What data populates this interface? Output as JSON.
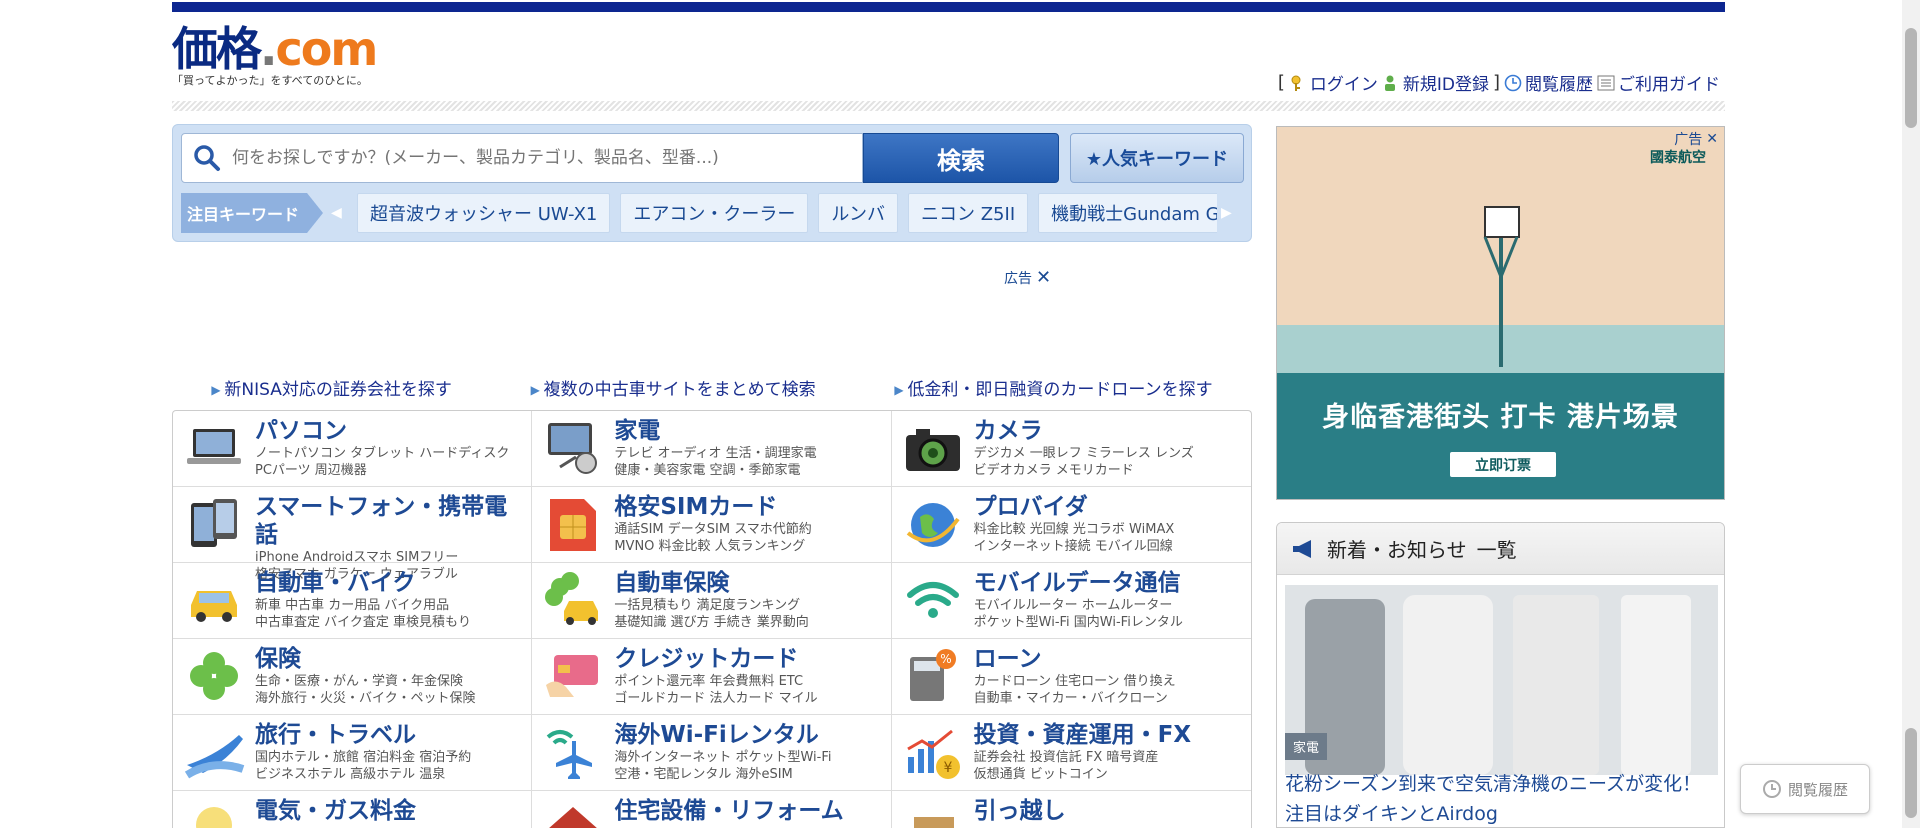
{
  "header": {
    "logo_main": "価格",
    "logo_dot": ".",
    "logo_com": "com",
    "tagline": "「買ってよかった」をすべてのひとに。",
    "links": {
      "open_bracket": "[",
      "login": "ログイン",
      "register": "新規ID登録",
      "close_bracket": "]",
      "history": "閲覧履歴",
      "guide": "ご利用ガイド"
    }
  },
  "search": {
    "placeholder": "何をお探しですか？(メーカー、製品カテゴリ、製品名、型番...)",
    "button": "検索",
    "popular": "★人気キーワード",
    "keyword_label": "注目キーワード",
    "keywords": [
      "超音波ウォッシャー UW-X1",
      "エアコン・クーラー",
      "ルンバ",
      "ニコン Z5II",
      "機動戦士Gundam G"
    ]
  },
  "ad": {
    "label": "広告",
    "close": "✕"
  },
  "promo_links": [
    "新NISA対応の証券会社を探す",
    "複数の中古車サイトをまとめて検索",
    "低金利・即日融資のカードローンを探す"
  ],
  "categories": [
    {
      "title": "パソコン",
      "sub1": "ノートパソコン  タブレット  ハードディスク",
      "sub2": "PCパーツ  周辺機器",
      "icon": "laptop-icon"
    },
    {
      "title": "家電",
      "sub1": "テレビ  オーディオ  生活・調理家電",
      "sub2": "健康・美容家電  空調・季節家電",
      "icon": "appliance-icon"
    },
    {
      "title": "カメラ",
      "sub1": "デジカメ  一眼レフ  ミラーレス  レンズ",
      "sub2": "ビデオカメラ  メモリカード",
      "icon": "camera-icon"
    },
    {
      "title": "スマートフォン・携帯電話",
      "sub1": "iPhone  Androidスマホ  SIMフリー",
      "sub2": "格安スマホ  ガラケー  ウェアラブル",
      "icon": "smartphone-icon"
    },
    {
      "title": "格安SIMカード",
      "sub1": "通話SIM  データSIM  スマホ代節約",
      "sub2": "MVNO  料金比較  人気ランキング",
      "icon": "sim-card-icon"
    },
    {
      "title": "プロバイダ",
      "sub1": "料金比較  光回線  光コラボ  WiMAX",
      "sub2": "インターネット接続  モバイル回線",
      "icon": "globe-icon"
    },
    {
      "title": "自動車・バイク",
      "sub1": "新車  中古車  カー用品  バイク用品",
      "sub2": "中古車査定  バイク査定  車検見積もり",
      "icon": "car-icon"
    },
    {
      "title": "自動車保険",
      "sub1": "一括見積もり  満足度ランキング",
      "sub2": "基礎知識  選び方  手続き  業界動向",
      "icon": "car-insurance-icon"
    },
    {
      "title": "モバイルデータ通信",
      "sub1": "モバイルルーター  ホームルーター",
      "sub2": "ポケット型Wi-Fi  国内Wi-Fiレンタル",
      "icon": "wifi-icon"
    },
    {
      "title": "保険",
      "sub1": "生命・医療・がん・学資・年金保険",
      "sub2": "海外旅行・火災・バイク・ペット保険",
      "icon": "clover-icon"
    },
    {
      "title": "クレジットカード",
      "sub1": "ポイント還元率  年会費無料  ETC",
      "sub2": "ゴールドカード  法人カード  マイル",
      "icon": "credit-card-icon"
    },
    {
      "title": "ローン",
      "sub1": "カードローン  住宅ローン  借り換え",
      "sub2": "自動車・マイカー・バイクローン",
      "icon": "calculator-icon"
    },
    {
      "title": "旅行・トラベル",
      "sub1": "国内ホテル・旅館  宿泊料金  宿泊予約",
      "sub2": "ビジネスホテル  高級ホテル  温泉",
      "icon": "airplane-icon"
    },
    {
      "title": "海外Wi-Fiレンタル",
      "sub1": "海外インターネット  ポケット型Wi-Fi",
      "sub2": "空港・宅配レンタル  海外eSIM",
      "icon": "wifi-plane-icon"
    },
    {
      "title": "投資・資産運用・FX",
      "sub1": "証券会社  投資信託  FX  暗号資産",
      "sub2": "仮想通貨  ビットコイン",
      "icon": "chart-yen-icon"
    },
    {
      "title": "電気・ガス料金",
      "sub1": "",
      "sub2": "",
      "icon": "bulb-icon"
    },
    {
      "title": "住宅設備・リフォーム",
      "sub1": "",
      "sub2": "",
      "icon": "house-icon"
    },
    {
      "title": "引っ越し",
      "sub1": "",
      "sub2": "",
      "icon": "box-icon"
    }
  ],
  "right_ad": {
    "label": "广告",
    "brand": "國泰航空",
    "headline": "身临香港街头 打卡 港片场景",
    "cta": "立即订票"
  },
  "news": {
    "title": "新着・お知らせ",
    "more": "一覧",
    "tag": "家電",
    "text": "花粉シーズン到来で空気清浄機のニーズが変化！ 注目はダイキンとAirdog"
  },
  "floating": {
    "history": "閲覧履歴"
  },
  "colors": {
    "brand_navy": "#0d2690",
    "accent_orange": "#ee7a1d",
    "link_blue": "#1e4a94"
  }
}
